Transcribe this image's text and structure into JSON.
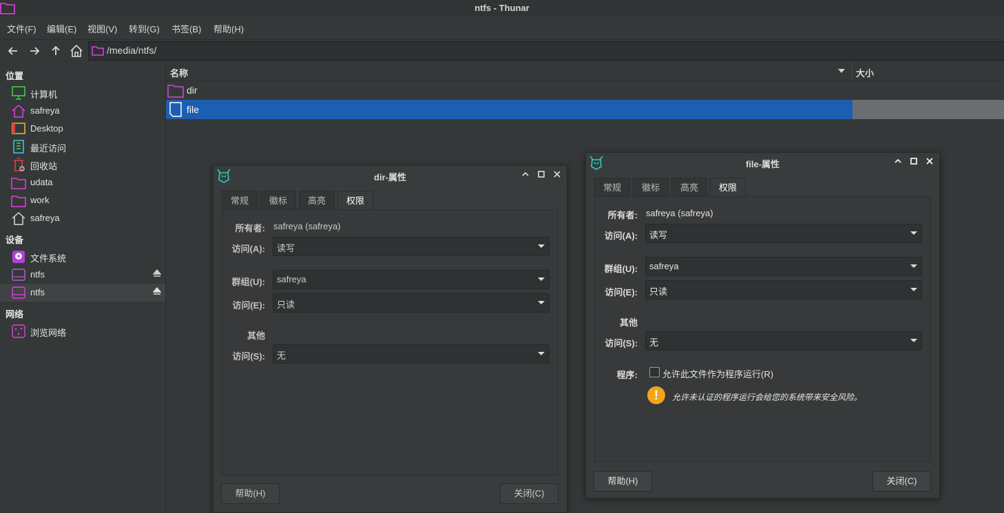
{
  "window": {
    "title": "ntfs - Thunar"
  },
  "menu": [
    "文件(F)",
    "编辑(E)",
    "视图(V)",
    "转到(G)",
    "书签(B)",
    "帮助(H)"
  ],
  "toolbar": {
    "back_icon": "arrow-left-icon",
    "forward_icon": "arrow-right-icon",
    "up_icon": "arrow-up-icon",
    "home_icon": "home-icon",
    "location": "/media/ntfs/"
  },
  "sidebar": {
    "places_header": "位置",
    "places": [
      {
        "label": "计算机",
        "icon": "computer-icon"
      },
      {
        "label": "safreya",
        "icon": "home-icon"
      },
      {
        "label": "Desktop",
        "icon": "desktop-icon"
      },
      {
        "label": "最近访问",
        "icon": "recent-icon"
      },
      {
        "label": "回收站",
        "icon": "trash-icon"
      },
      {
        "label": "udata",
        "icon": "folder-icon"
      },
      {
        "label": "work",
        "icon": "folder-icon"
      },
      {
        "label": "safreya",
        "icon": "home-icon"
      }
    ],
    "devices_header": "设备",
    "devices": [
      {
        "label": "文件系统",
        "icon": "harddisk-icon"
      },
      {
        "label": "ntfs",
        "icon": "drive-icon"
      },
      {
        "label": "ntfs",
        "icon": "drive-icon"
      }
    ],
    "network_header": "网络",
    "network": [
      {
        "label": "浏览网络",
        "icon": "network-icon"
      }
    ]
  },
  "file_list": {
    "columns": [
      "名称",
      "大小"
    ],
    "rows": [
      {
        "name": "dir",
        "icon": "folder-icon"
      },
      {
        "name": "file",
        "icon": "file-icon"
      }
    ]
  },
  "dir_dialog": {
    "title": "dir-属性",
    "tabs": [
      "常规",
      "徽标",
      "高亮",
      "权限"
    ],
    "owner_label": "所有者:",
    "owner_value": "safreya (safreya)",
    "owner_access_label": "访问(A):",
    "owner_access_value": "读写",
    "group_label": "群组(U):",
    "group_value": "safreya",
    "group_access_label": "访问(E):",
    "group_access_value": "只读",
    "others_label": "其他",
    "others_access_label": "访问(S):",
    "others_access_value": "无",
    "help_button": "帮助(H)",
    "close_button": "关闭(C)"
  },
  "file_dialog": {
    "title": "file-属性",
    "tabs": [
      "常规",
      "徽标",
      "高亮",
      "权限"
    ],
    "owner_label": "所有者:",
    "owner_value": "safreya (safreya)",
    "owner_access_label": "访问(A):",
    "owner_access_value": "读写",
    "group_label": "群组(U):",
    "group_value": "safreya",
    "group_access_label": "访问(E):",
    "group_access_value": "只读",
    "others_label": "其他",
    "others_access_label": "访问(S):",
    "others_access_value": "无",
    "program_label": "程序:",
    "exec_checkbox_label": "允许此文件作为程序运行(R)",
    "warning_text": "允许未认证的程序运行会给您的系统带来安全风险。",
    "help_button": "帮助(H)",
    "close_button": "关闭(C)"
  }
}
